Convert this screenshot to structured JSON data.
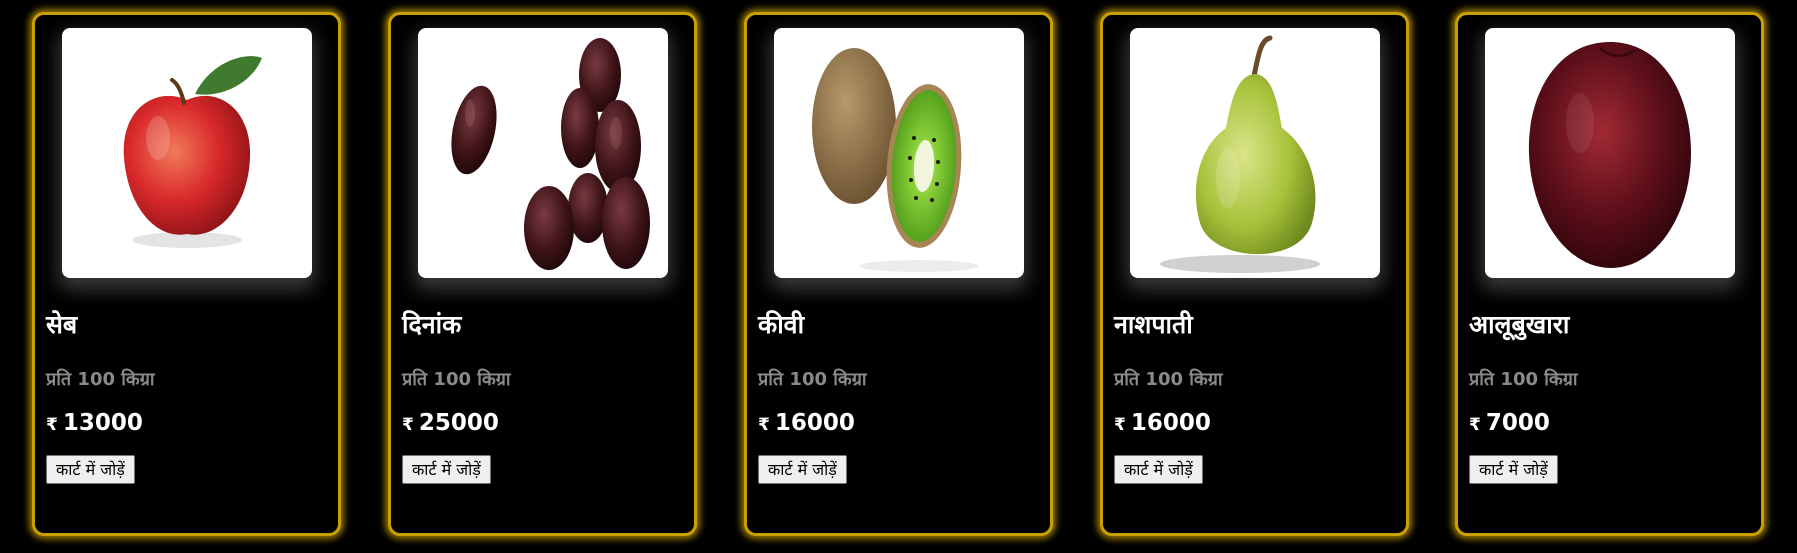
{
  "currency_symbol": "₹",
  "products": [
    {
      "name": "सेब",
      "unit": "प्रति 100 किग्रा",
      "price": "13000",
      "button_label": "कार्ट में जोड़ें",
      "image_icon": "apple"
    },
    {
      "name": "दिनांक",
      "unit": "प्रति 100 किग्रा",
      "price": "25000",
      "button_label": "कार्ट में जोड़ें",
      "image_icon": "dates"
    },
    {
      "name": "कीवी",
      "unit": "प्रति 100 किग्रा",
      "price": "16000",
      "button_label": "कार्ट में जोड़ें",
      "image_icon": "kiwi"
    },
    {
      "name": "नाशपाती",
      "unit": "प्रति 100 किग्रा",
      "price": "16000",
      "button_label": "कार्ट में जोड़ें",
      "image_icon": "pear"
    },
    {
      "name": "आलूबुखारा",
      "unit": "प्रति 100 किग्रा",
      "price": "7000",
      "button_label": "कार्ट में जोड़ें",
      "image_icon": "plum"
    }
  ],
  "colors": {
    "background": "#000000",
    "card_border": "#c9a000",
    "unit_text": "#8a8a8a"
  }
}
